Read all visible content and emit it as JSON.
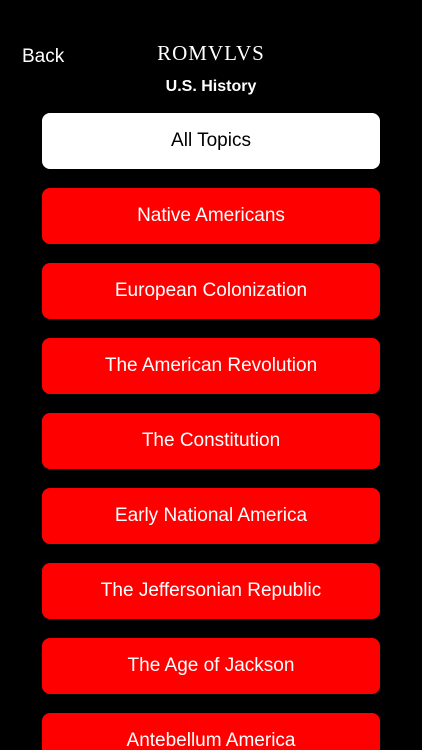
{
  "header": {
    "back_label": "Back",
    "brand": "ROMVLVS",
    "subtitle": "U.S. History"
  },
  "colors": {
    "background": "#000000",
    "topic_button": "#ff0000",
    "selected_button": "#ffffff"
  },
  "topics": [
    {
      "label": "All Topics",
      "selected": true
    },
    {
      "label": "Native Americans",
      "selected": false
    },
    {
      "label": "European Colonization",
      "selected": false
    },
    {
      "label": "The American Revolution",
      "selected": false
    },
    {
      "label": "The Constitution",
      "selected": false
    },
    {
      "label": "Early National America",
      "selected": false
    },
    {
      "label": "The Jeffersonian Republic",
      "selected": false
    },
    {
      "label": "The Age of Jackson",
      "selected": false
    },
    {
      "label": "Antebellum America",
      "selected": false
    }
  ]
}
